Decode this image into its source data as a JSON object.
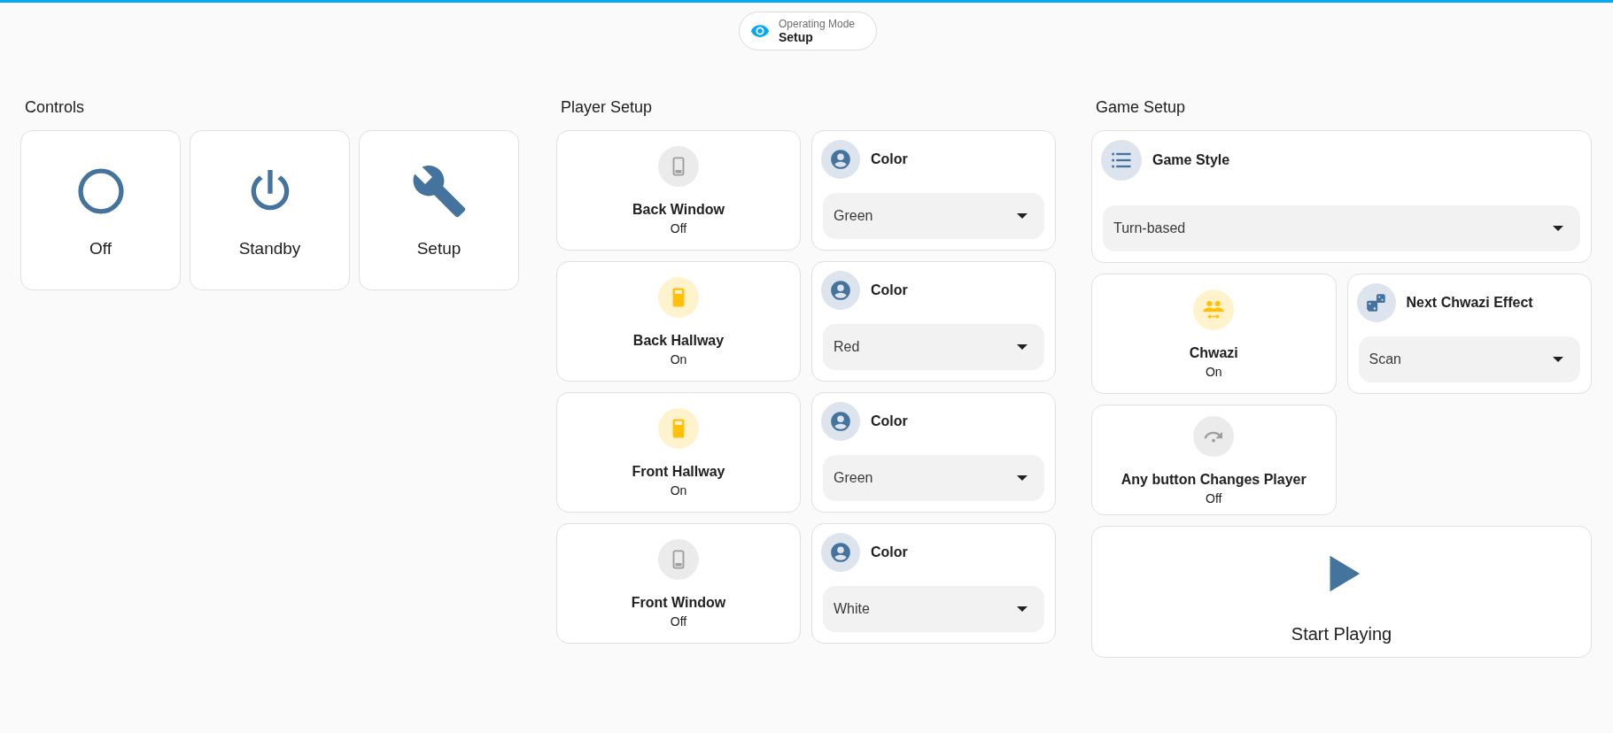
{
  "mode_badge": {
    "label": "Operating Mode",
    "value": "Setup"
  },
  "controls": {
    "title": "Controls",
    "buttons": [
      {
        "label": "Off"
      },
      {
        "label": "Standby"
      },
      {
        "label": "Setup"
      }
    ]
  },
  "player_setup": {
    "title": "Player Setup",
    "rows": [
      {
        "light": {
          "name": "Back Window",
          "state": "Off",
          "on": false
        },
        "color": {
          "label": "Color",
          "value": "Green"
        }
      },
      {
        "light": {
          "name": "Back Hallway",
          "state": "On",
          "on": true
        },
        "color": {
          "label": "Color",
          "value": "Red"
        }
      },
      {
        "light": {
          "name": "Front Hallway",
          "state": "On",
          "on": true
        },
        "color": {
          "label": "Color",
          "value": "Green"
        }
      },
      {
        "light": {
          "name": "Front Window",
          "state": "Off",
          "on": false
        },
        "color": {
          "label": "Color",
          "value": "White"
        }
      }
    ]
  },
  "game_setup": {
    "title": "Game Setup",
    "rows": [
      [
        {
          "kind": "select",
          "label": "Game Style",
          "value": "Turn-based"
        }
      ],
      [
        {
          "kind": "toggle",
          "name": "Chwazi",
          "state": "On",
          "on": true
        },
        {
          "kind": "select",
          "label": "Next Chwazi Effect",
          "value": "Scan"
        }
      ],
      [
        {
          "kind": "toggle",
          "name": "Any button Changes Player",
          "state": "Off",
          "on": false
        }
      ],
      [
        {
          "kind": "button",
          "label": "Start Playing"
        }
      ]
    ]
  }
}
